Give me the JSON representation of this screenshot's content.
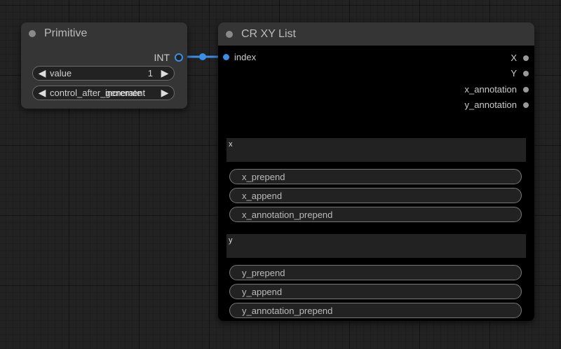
{
  "primitive": {
    "title": "Primitive",
    "output_label": "INT",
    "widgets": [
      {
        "label": "value",
        "value": "1"
      },
      {
        "label": "control_after_generate",
        "value": "increment"
      }
    ]
  },
  "crxy": {
    "title": "CR XY List",
    "input_label": "index",
    "outputs": [
      "X",
      "Y",
      "x_annotation",
      "y_annotation"
    ],
    "x_text_label": "x",
    "y_text_label": "y",
    "x_widgets": [
      "x_prepend",
      "x_append",
      "x_annotation_prepend"
    ],
    "y_widgets": [
      "y_prepend",
      "y_append",
      "y_annotation_prepend"
    ]
  },
  "colors": {
    "link": "#3a8ee6",
    "node_bg": "#353535",
    "canvas_bg": "#222222"
  },
  "icons": {
    "left_arrow": "◀",
    "right_arrow": "▶"
  }
}
